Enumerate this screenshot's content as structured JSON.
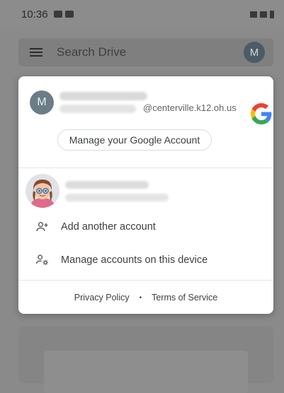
{
  "status_bar": {
    "time": "10:36"
  },
  "search": {
    "placeholder": "Search Drive",
    "avatar_initial": "M"
  },
  "account_sheet": {
    "primary": {
      "avatar_initial": "M",
      "email_domain": "@centerville.k12.oh.us"
    },
    "manage_button_label": "Manage your Google Account",
    "add_account_label": "Add another account",
    "manage_device_label": "Manage accounts on this device",
    "footer": {
      "privacy": "Privacy Policy",
      "separator": "•",
      "terms": "Terms of Service"
    }
  },
  "colors": {
    "google_blue": "#4285F4",
    "google_red": "#EA4335",
    "google_yellow": "#FBBC05",
    "google_green": "#34A853"
  },
  "icons": {
    "menu": "hamburger-icon",
    "add_account": "person-add-icon",
    "manage_accounts": "manage-accounts-icon",
    "logo": "google-g-logo"
  }
}
